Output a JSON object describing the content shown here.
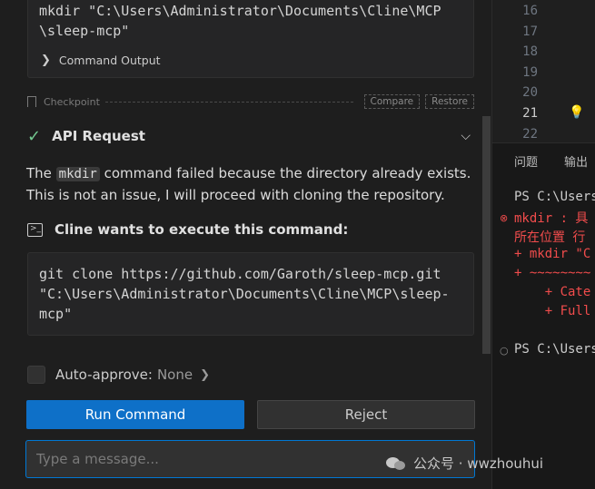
{
  "previous_command": {
    "lines": [
      "mkdir \"C:\\Users\\Administrator\\Documents\\Cline\\MCP",
      "\\sleep-mcp\""
    ],
    "output_toggle_label": "Command Output"
  },
  "checkpoint": {
    "label": "Checkpoint",
    "compare_label": "Compare",
    "restore_label": "Restore"
  },
  "api_request": {
    "title": "API Request"
  },
  "message": {
    "prefix": "The ",
    "code": "mkdir",
    "suffix": " command failed because the directory already exists. This is not an issue, I will proceed with cloning the repository."
  },
  "execute_prompt": {
    "title": "Cline wants to execute this command:"
  },
  "current_command": {
    "lines": [
      "git clone https://github.com/Garoth/sleep-mcp.git",
      "\"C:\\Users\\Administrator\\Documents\\Cline\\MCP\\sleep-",
      "mcp\""
    ]
  },
  "auto_approve": {
    "label": "Auto-approve:",
    "value": "None"
  },
  "actions": {
    "run_label": "Run Command",
    "reject_label": "Reject"
  },
  "input": {
    "placeholder": "Type a message..."
  },
  "editor": {
    "line_numbers": [
      "16",
      "17",
      "18",
      "19",
      "20",
      "21",
      "22"
    ],
    "active_line": "21"
  },
  "terminal": {
    "tabs": [
      "问题",
      "输出"
    ],
    "lines": [
      {
        "text": "PS C:\\Users",
        "color": "white"
      },
      {
        "text": "mkdir : 具",
        "color": "red"
      },
      {
        "text": "所在位置 行",
        "color": "red"
      },
      {
        "text": "+ mkdir \"C",
        "color": "red"
      },
      {
        "text": "+ ~~~~~~~~",
        "color": "red"
      },
      {
        "text": "    + Cate",
        "color": "red"
      },
      {
        "text": "    + Full",
        "color": "red"
      },
      {
        "text": "PS C:\\Users",
        "color": "white"
      }
    ]
  },
  "watermark": {
    "text": "公众号 · wwzhouhui"
  },
  "colors": {
    "accent": "#0e70c8",
    "success": "#73c991",
    "error": "#f14c4c",
    "focus_border": "#0078d4"
  }
}
